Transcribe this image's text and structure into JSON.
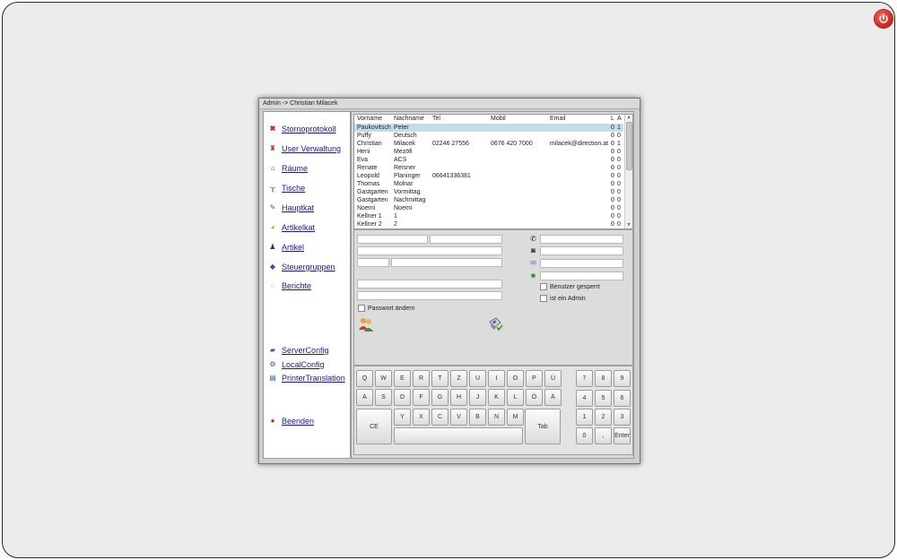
{
  "window": {
    "title": "Admin -> Christian Milacek"
  },
  "sidebar": {
    "items": [
      {
        "label": "Stornoprotokoll",
        "icon": "red-x-icon"
      },
      {
        "label": "User Verwaltung",
        "icon": "user-icon"
      },
      {
        "label": "Räume",
        "icon": "rooms-icon"
      },
      {
        "label": "Tische",
        "icon": "table-icon"
      },
      {
        "label": "Hauptkat",
        "icon": "notepad-icon"
      },
      {
        "label": "Artikelkat",
        "icon": "category-icon"
      },
      {
        "label": "Artikel",
        "icon": "article-icon"
      },
      {
        "label": "Steuergruppen",
        "icon": "tax-icon"
      },
      {
        "label": "Berichte",
        "icon": "report-icon"
      },
      {
        "label": "ServerConfig",
        "icon": "server-icon"
      },
      {
        "label": "LocalConfig",
        "icon": "local-config-icon"
      },
      {
        "label": "PrinterTranslation",
        "icon": "printer-icon"
      },
      {
        "label": "Beenden",
        "icon": "exit-icon"
      }
    ]
  },
  "users_table": {
    "columns": [
      "Vorname",
      "Nachname",
      "Tel",
      "Mobil",
      "Email",
      "L",
      "A"
    ],
    "rows": [
      [
        "Paukovitsch",
        "Peter",
        "",
        "",
        "",
        "0",
        "1"
      ],
      [
        "Puffy",
        "Deutsch",
        "",
        "",
        "",
        "0",
        "0"
      ],
      [
        "Christian",
        "Milacek",
        "02246 27556",
        "0676 420 7000",
        "milacek@direction.at",
        "0",
        "1"
      ],
      [
        "Heni",
        "Mezöfi",
        "",
        "",
        "",
        "0",
        "0"
      ],
      [
        "Eva",
        "ACS",
        "",
        "",
        "",
        "0",
        "0"
      ],
      [
        "Renate",
        "Reisner",
        "",
        "",
        "",
        "0",
        "0"
      ],
      [
        "Leopold",
        "Planinger",
        "06641336381",
        "",
        "",
        "0",
        "0"
      ],
      [
        "Thomas",
        "Molnar",
        "",
        "",
        "",
        "0",
        "0"
      ],
      [
        "Gastgarten",
        "Vormittag",
        "",
        "",
        "",
        "0",
        "0"
      ],
      [
        "Gastgarten",
        "Nachmittag",
        "",
        "",
        "",
        "0",
        "0"
      ],
      [
        "Noemi",
        "Noemi",
        "",
        "",
        "",
        "0",
        "0"
      ],
      [
        "Kellner 1",
        "1",
        "",
        "",
        "",
        "0",
        "0"
      ],
      [
        "Kellner 2",
        "2",
        "",
        "",
        "",
        "0",
        "0"
      ]
    ],
    "selected_row": 0
  },
  "form": {
    "password_change_label": "Passwort ändern",
    "user_locked_label": "Benutzer gesperrt",
    "is_admin_label": "ist ein Admin"
  },
  "keyboard": {
    "row1": [
      "Q",
      "W",
      "E",
      "R",
      "T",
      "Z",
      "U",
      "I",
      "O",
      "P",
      "Ü"
    ],
    "row2": [
      "A",
      "S",
      "D",
      "F",
      "G",
      "H",
      "J",
      "K",
      "L",
      "Ö",
      "Ä"
    ],
    "row3": [
      "Y",
      "X",
      "C",
      "V",
      "B",
      "N",
      "M"
    ],
    "ce": "CE",
    "tab": "Tab",
    "numpad": [
      [
        "7",
        "8",
        "9"
      ],
      [
        "4",
        "5",
        "6"
      ],
      [
        "1",
        "2",
        "3"
      ]
    ],
    "zero": "0",
    "comma": ",",
    "enter": "Enter"
  }
}
